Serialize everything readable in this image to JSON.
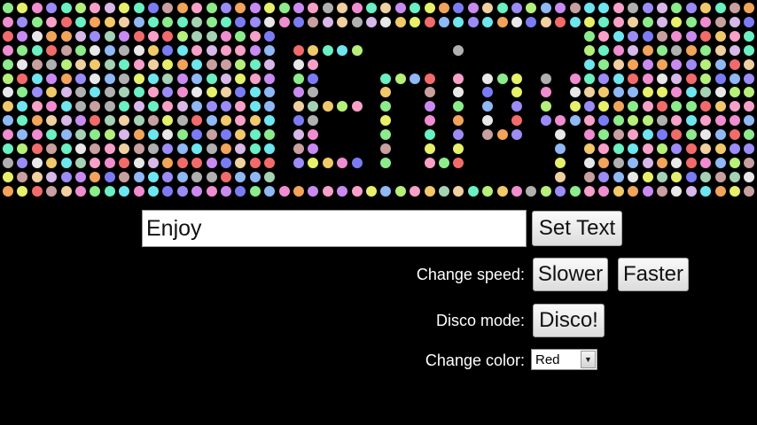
{
  "dot_matrix": {
    "display_text": "Enjoy",
    "palette": [
      "#f26b6b",
      "#f7a0c8",
      "#f08cd0",
      "#c98bf2",
      "#9b8cf7",
      "#7b7cf5",
      "#8fb8f5",
      "#6ee6f0",
      "#6af0c2",
      "#8cec8c",
      "#b6f07a",
      "#e6f06a",
      "#f2c96a",
      "#f2a45a",
      "#e8e8e8",
      "#c8a0a0",
      "#a5d2b4",
      "#d8b8e8",
      "#b0b0b0",
      "#f0d0a0"
    ]
  },
  "text_input": {
    "value": "Enjoy",
    "placeholder": ""
  },
  "buttons": {
    "set_text": "Set Text",
    "slower": "Slower",
    "faster": "Faster",
    "disco": "Disco!"
  },
  "labels": {
    "change_speed": "Change speed:",
    "disco_mode": "Disco mode:",
    "change_color": "Change color:"
  },
  "color_select": {
    "selected": "Red",
    "arrow_icon": "chevron-down-icon"
  }
}
